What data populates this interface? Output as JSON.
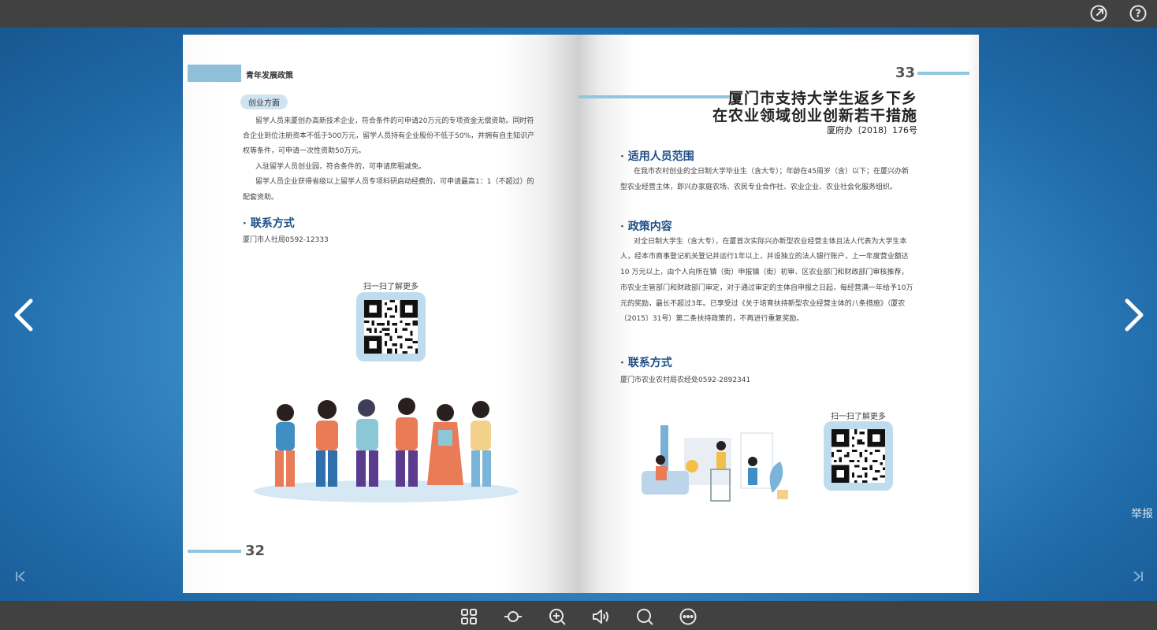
{
  "toolbar_top": {
    "share_icon": "share-icon",
    "help_icon": "help-icon"
  },
  "nav": {
    "report_label": "举报"
  },
  "left_page": {
    "header_title": "青年发展政策",
    "section_pill": "创业方面",
    "paragraphs": [
      "留学人员来厦创办高新技术企业，符合条件的可申请20万元的专项资金无偿资助。同时符",
      "合企业到位注册资本不低于500万元，留学人员持有企业股份不低于50%，并拥有自主知识产",
      "权等条件，可申请一次性资助50万元。",
      "入驻留学人员创业园，符合条件的，可申请房租减免。",
      "留学人员企业获得省级以上留学人员专项科研启动经费的，可申请最高1：1（不超过）的",
      "配套资助。"
    ],
    "contact_heading": "· 联系方式",
    "contact_text": "厦门市人社局0592-12333",
    "qr_caption": "扫一扫了解更多",
    "page_number": "32"
  },
  "right_page": {
    "page_number": "33",
    "title_line1": "厦门市支持大学生返乡下乡",
    "title_line2": "在农业领域创业创新若干措施",
    "doc_number": "厦府办〔2018〕176号",
    "scope_heading": "· 适用人员范围",
    "scope_lines": [
      "在我市农村创业的全日制大学毕业生（含大专）；年龄在45周岁（含）以下；在厦兴办新",
      "型农业经营主体，即兴办家庭农场、农民专业合作社、农业企业、农业社会化服务组织。"
    ],
    "policy_heading": "· 政策内容",
    "policy_lines": [
      "对全日制大学生（含大专），在厦首次实际兴办新型农业经营主体且法人代表为大学生本",
      "人，经本市商事登记机关登记并运行1年以上，并设独立的法人银行账户，上一年度营业额达",
      "10 万元以上，由个人向所在镇（街）申报镇（街）初审、区农业部门和财政部门审核推荐，",
      "市农业主管部门和财政部门审定，对于通过审定的主体自申报之日起，每经营满一年给予10万",
      "元的奖励，最长不超过3年。已享受过《关于培育扶持新型农业经营主体的八条措施》（厦农",
      "〔2015〕31号）第二条扶持政策的，不再进行重复奖励。"
    ],
    "contact_heading": "· 联系方式",
    "contact_text": "厦门市农业农村局农经处0592-2892341",
    "qr_caption": "扫一扫了解更多"
  },
  "toolbar_bottom": {
    "icons": [
      "thumbnails-icon",
      "autoflip-icon",
      "zoom-in-icon",
      "sound-icon",
      "search-icon",
      "more-icon"
    ]
  },
  "colors": {
    "accent_blue": "#1f4f86",
    "rule_blue": "#8fc7df",
    "bar_gray": "#414141"
  }
}
